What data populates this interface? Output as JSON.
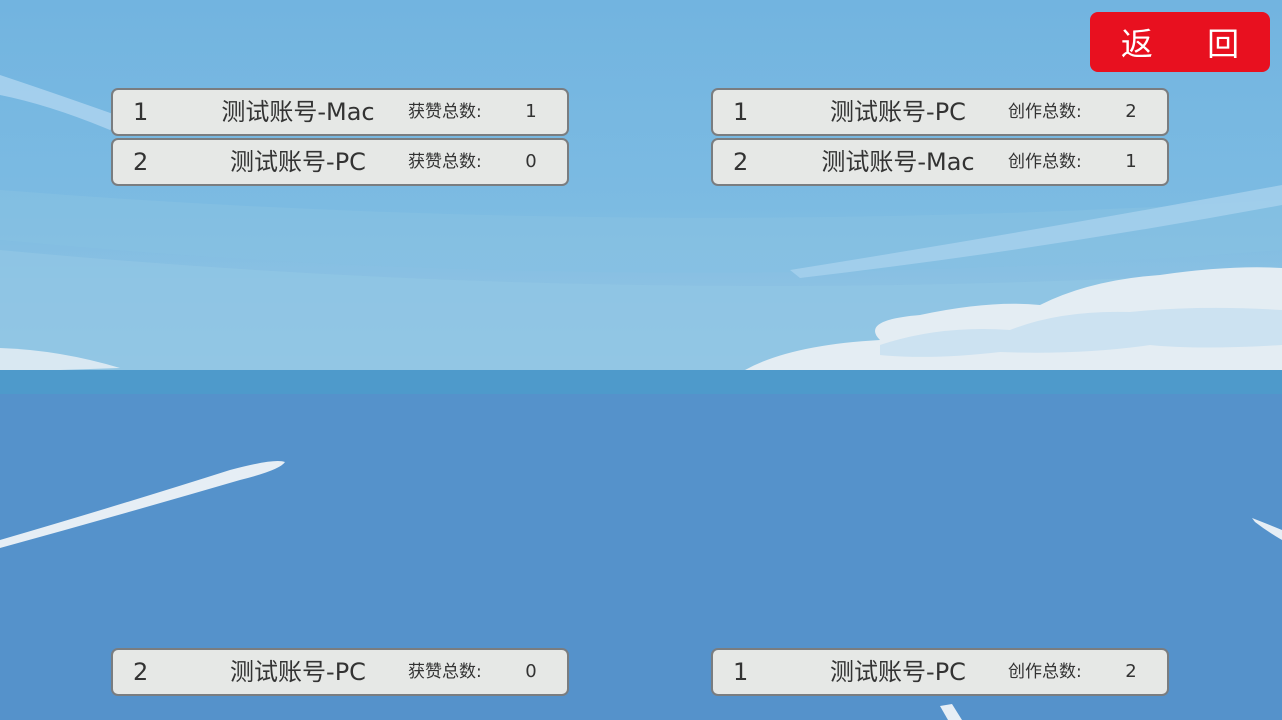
{
  "colors": {
    "back_button_bg": "#e8101f",
    "row_bg": "#e6e8e6",
    "sky_top": "#72b4e0",
    "sea": "#5592cb"
  },
  "back_button": {
    "label": "返 回"
  },
  "left_panel": {
    "top_rows": [
      {
        "rank": "1",
        "account": "测试账号-Mac",
        "stat_label": "获赞总数:",
        "stat_value": "1"
      },
      {
        "rank": "2",
        "account": "测试账号-PC",
        "stat_label": "获赞总数:",
        "stat_value": "0"
      }
    ],
    "self_row": {
      "rank": "2",
      "account": "测试账号-PC",
      "stat_label": "获赞总数:",
      "stat_value": "0"
    }
  },
  "right_panel": {
    "top_rows": [
      {
        "rank": "1",
        "account": "测试账号-PC",
        "stat_label": "创作总数:",
        "stat_value": "2"
      },
      {
        "rank": "2",
        "account": "测试账号-Mac",
        "stat_label": "创作总数:",
        "stat_value": "1"
      }
    ],
    "self_row": {
      "rank": "1",
      "account": "测试账号-PC",
      "stat_label": "创作总数:",
      "stat_value": "2"
    }
  }
}
